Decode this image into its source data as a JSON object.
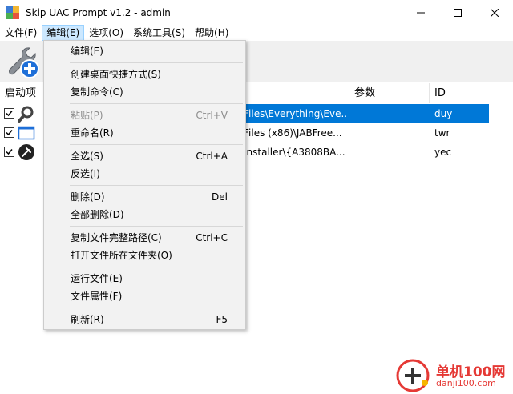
{
  "window": {
    "title": "Skip UAC Prompt v1.2 - admin"
  },
  "menubar": {
    "items": [
      {
        "label": "文件(F)"
      },
      {
        "label": "编辑(E)"
      },
      {
        "label": "选项(O)"
      },
      {
        "label": "系统工具(S)"
      },
      {
        "label": "帮助(H)"
      }
    ]
  },
  "list": {
    "columns": [
      {
        "label": "启动项"
      },
      {
        "label": "参数"
      },
      {
        "label": "ID"
      }
    ],
    "rows": [
      {
        "checked": true,
        "icon": "search-icon",
        "path": "Files\\Everything\\Eve...",
        "id": "duy",
        "selected": true
      },
      {
        "checked": true,
        "icon": "window-icon",
        "path": "Files (x86)\\JABFree...",
        "id": "twr",
        "selected": false
      },
      {
        "checked": true,
        "icon": "pin-icon",
        "path": "Installer\\{A3808BA...",
        "id": "yec",
        "selected": false
      }
    ]
  },
  "dropdown": {
    "items": [
      {
        "label": "编辑(E)",
        "shortcut": ""
      },
      {
        "label": "创建桌面快捷方式(S)",
        "shortcut": ""
      },
      {
        "label": "复制命令(C)",
        "shortcut": ""
      },
      {
        "label": "粘贴(P)",
        "shortcut": "Ctrl+V",
        "disabled": true
      },
      {
        "label": "重命名(R)",
        "shortcut": ""
      },
      {
        "label": "全选(S)",
        "shortcut": "Ctrl+A"
      },
      {
        "label": "反选(I)",
        "shortcut": ""
      },
      {
        "label": "删除(D)",
        "shortcut": "Del"
      },
      {
        "label": "全部删除(D)",
        "shortcut": ""
      },
      {
        "label": "复制文件完整路径(C)",
        "shortcut": "Ctrl+C"
      },
      {
        "label": "打开文件所在文件夹(O)",
        "shortcut": ""
      },
      {
        "label": "运行文件(E)",
        "shortcut": ""
      },
      {
        "label": "文件属性(F)",
        "shortcut": ""
      },
      {
        "label": "刷新(R)",
        "shortcut": "F5"
      }
    ]
  },
  "watermark": {
    "brand": "单机100网",
    "url": "danji100.com"
  },
  "colors": {
    "selection": "#0078d7",
    "menu_active": "#cce8ff",
    "watermark": "#e53935"
  }
}
